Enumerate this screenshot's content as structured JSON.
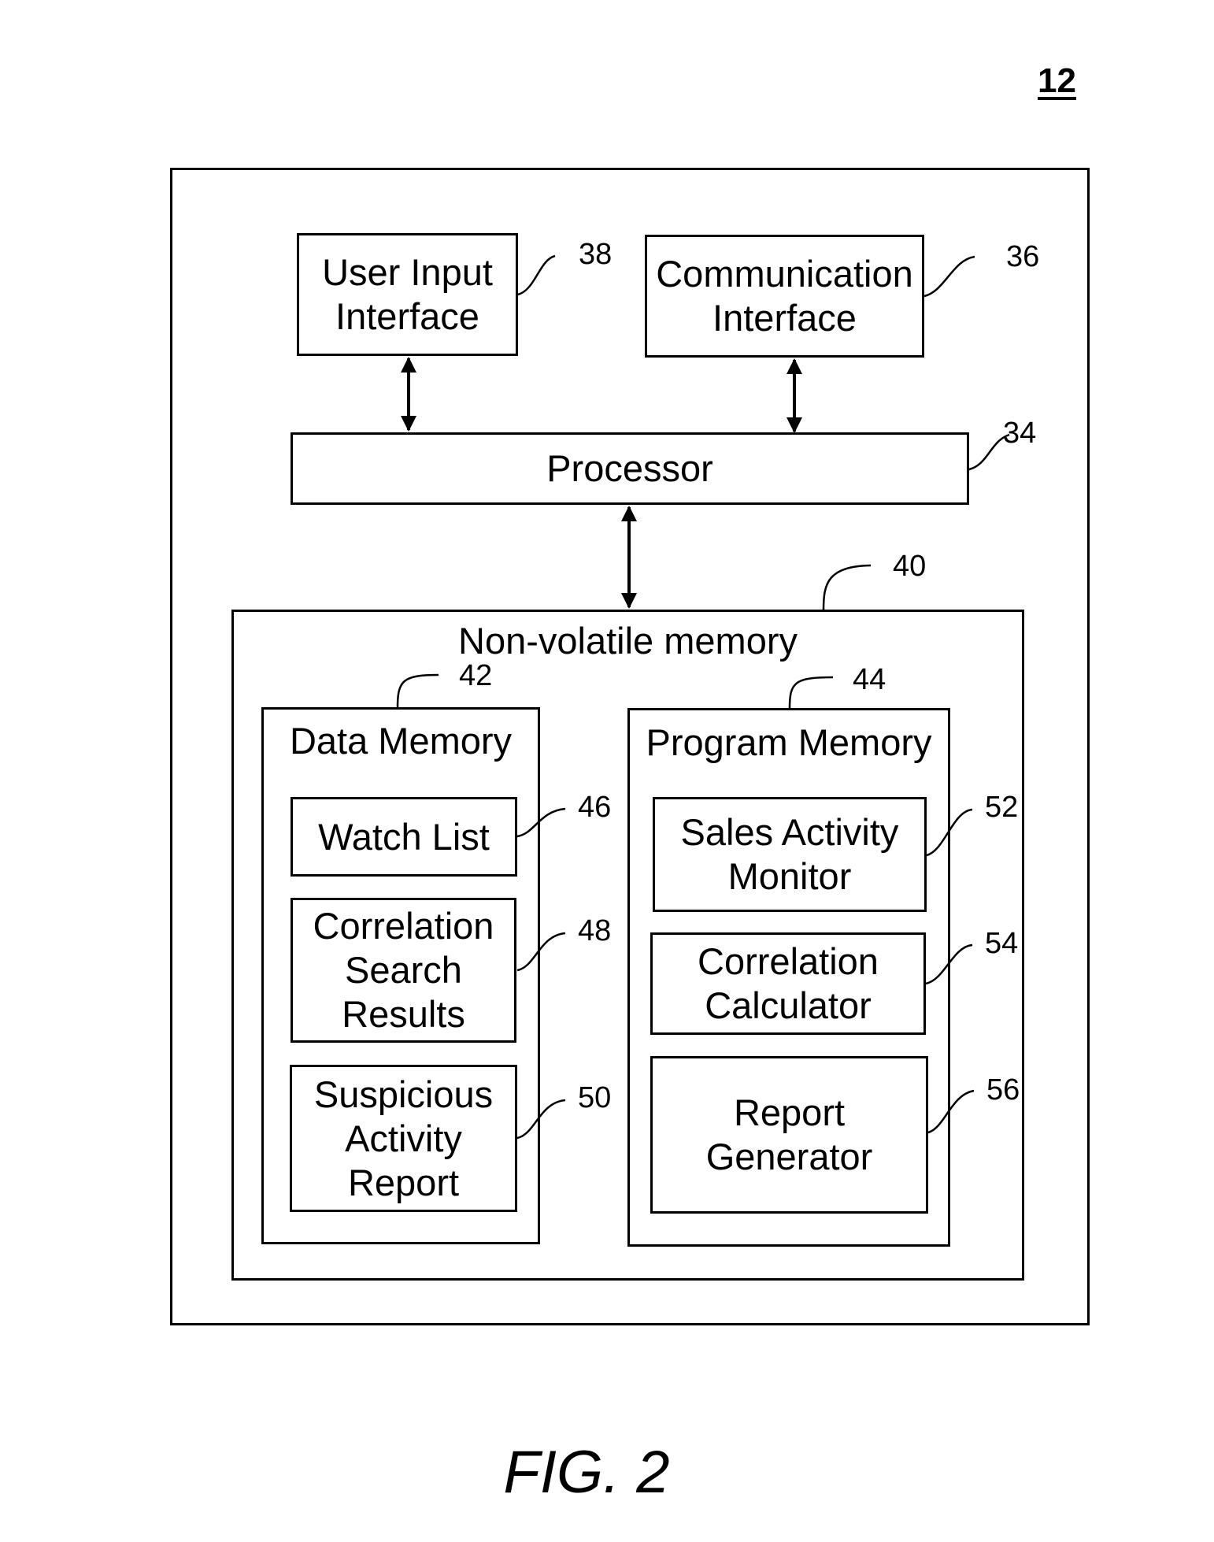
{
  "figure": {
    "number": "12",
    "caption": "FIG. 2"
  },
  "blocks": {
    "outer_device": {
      "ref": "12"
    },
    "user_input_interface": {
      "label": "User Input\nInterface",
      "ref": "38"
    },
    "communication_interface": {
      "label": "Communication\nInterface",
      "ref": "36"
    },
    "processor": {
      "label": "Processor",
      "ref": "34"
    },
    "non_volatile_memory": {
      "label": "Non-volatile memory",
      "ref": "40"
    },
    "data_memory": {
      "label": "Data Memory",
      "ref": "42",
      "items": [
        {
          "label": "Watch List",
          "ref": "46"
        },
        {
          "label": "Correlation\nSearch\nResults",
          "ref": "48"
        },
        {
          "label": "Suspicious\nActivity\nReport",
          "ref": "50"
        }
      ]
    },
    "program_memory": {
      "label": "Program Memory",
      "ref": "44",
      "items": [
        {
          "label": "Sales Activity\nMonitor",
          "ref": "52"
        },
        {
          "label": "Correlation\nCalculator",
          "ref": "54"
        },
        {
          "label": "Report\nGenerator",
          "ref": "56"
        }
      ]
    }
  },
  "connections": [
    {
      "from": "user_input_interface",
      "to": "processor",
      "type": "bidirectional"
    },
    {
      "from": "communication_interface",
      "to": "processor",
      "type": "bidirectional"
    },
    {
      "from": "processor",
      "to": "non_volatile_memory",
      "type": "bidirectional"
    }
  ]
}
